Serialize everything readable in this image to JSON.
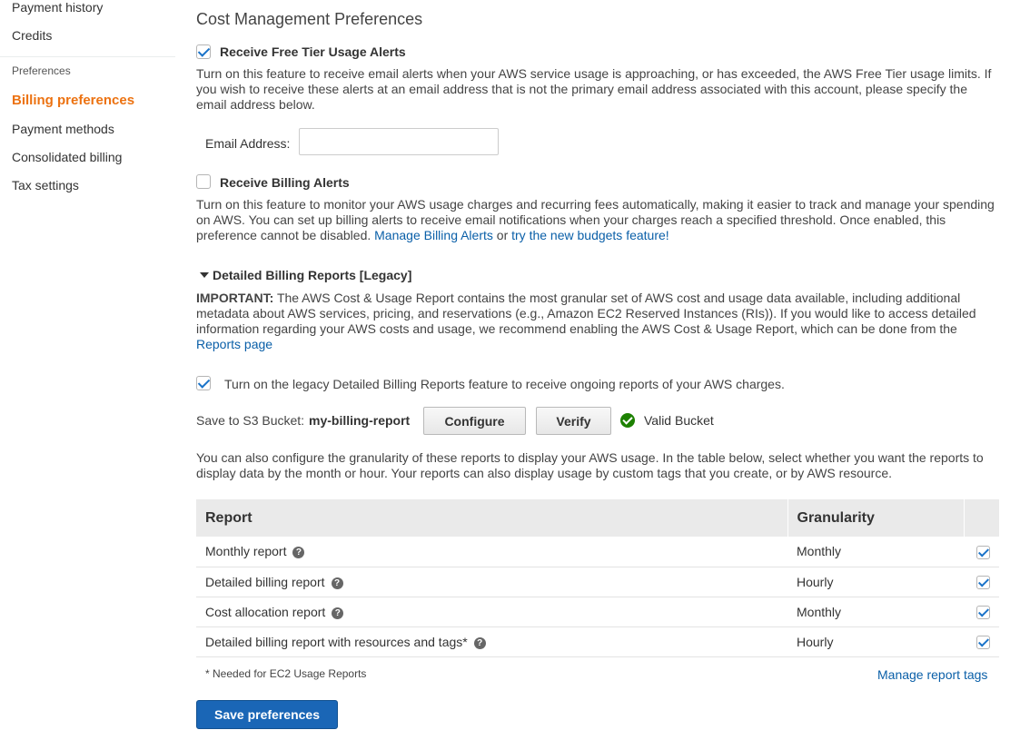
{
  "sidebar": {
    "items_top": [
      {
        "label": "Payment history"
      },
      {
        "label": "Credits"
      }
    ],
    "section_label": "Preferences",
    "items": [
      {
        "label": "Billing preferences",
        "active": true
      },
      {
        "label": "Payment methods"
      },
      {
        "label": "Consolidated billing"
      },
      {
        "label": "Tax settings"
      }
    ]
  },
  "page": {
    "title": "Cost Management Preferences"
  },
  "free_tier": {
    "label": "Receive Free Tier Usage Alerts",
    "checked": true,
    "description": "Turn on this feature to receive email alerts when your AWS service usage is approaching, or has exceeded, the AWS Free Tier usage limits. If you wish to receive these alerts at an email address that is not the primary email address associated with this account, please specify the email address below.",
    "email_label": "Email Address:",
    "email_value": ""
  },
  "billing_alerts": {
    "label": "Receive Billing Alerts",
    "checked": false,
    "description": "Turn on this feature to monitor your AWS usage charges and recurring fees automatically, making it easier to track and manage your spending on AWS. You can set up billing alerts to receive email notifications when your charges reach a specified threshold. Once enabled, this preference cannot be disabled.",
    "link_manage": "Manage Billing Alerts",
    "or_text": "or",
    "link_budgets": "try the new budgets feature!"
  },
  "detailed": {
    "heading": "Detailed Billing Reports [Legacy]",
    "important_label": "IMPORTANT:",
    "important_text": "The AWS Cost & Usage Report contains the most granular set of AWS cost and usage data available, including additional metadata about AWS services, pricing, and reservations (e.g., Amazon EC2 Reserved Instances (RIs)). If you would like to access detailed information regarding your AWS costs and usage, we recommend enabling the AWS Cost & Usage Report, which can be done from the",
    "reports_link": "Reports page",
    "toggle_label": "Turn on the legacy Detailed Billing Reports feature to receive ongoing reports of your AWS charges.",
    "toggle_checked": true,
    "s3_label": "Save to S3 Bucket:",
    "s3_bucket": "my-billing-report",
    "configure_label": "Configure",
    "verify_label": "Verify",
    "valid_label": "Valid Bucket",
    "granularity_text": "You can also configure the granularity of these reports to display your AWS usage. In the table below, select whether you want the reports to display data by the month or hour. Your reports can also display usage by custom tags that you create, or by AWS resource."
  },
  "report_table": {
    "headers": [
      "Report",
      "Granularity"
    ],
    "rows": [
      {
        "report": "Monthly report",
        "granularity": "Monthly",
        "checked": true
      },
      {
        "report": "Detailed billing report",
        "granularity": "Hourly",
        "checked": true
      },
      {
        "report": "Cost allocation report",
        "granularity": "Monthly",
        "checked": true
      },
      {
        "report": "Detailed billing report with resources and tags*",
        "granularity": "Hourly",
        "checked": true
      }
    ],
    "footnote": "* Needed for EC2 Usage Reports",
    "manage_tags_link": "Manage report tags"
  },
  "save_button": "Save preferences",
  "colors": {
    "accent_orange": "#ec7211",
    "link_blue": "#0a5fa8",
    "primary_button": "#1a66b6",
    "valid_green": "#1d8102"
  }
}
